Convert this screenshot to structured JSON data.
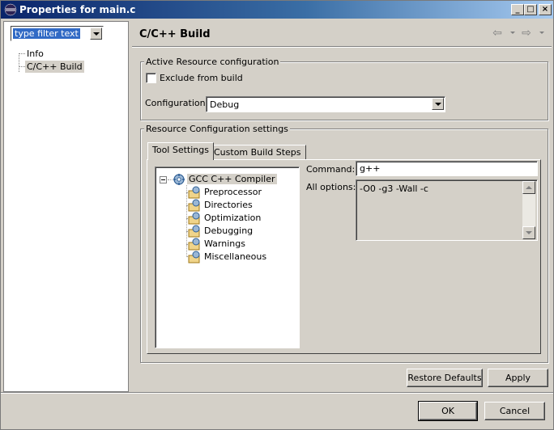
{
  "window": {
    "title": "Properties for main.c",
    "controls": {
      "minimize": "_",
      "maximize": "□",
      "close": "×"
    }
  },
  "sidebar": {
    "filter_text": "type filter text",
    "items": [
      {
        "label": "Info",
        "selected": false
      },
      {
        "label": "C/C++ Build",
        "selected": true
      }
    ]
  },
  "page": {
    "title": "C/C++ Build",
    "back_icon": "back-arrow-icon",
    "forward_icon": "forward-arrow-icon"
  },
  "active_resource": {
    "legend": "Active Resource configuration",
    "exclude_label": "Exclude from build",
    "exclude_checked": false,
    "configuration_label": "Configuration:",
    "configuration_value": "Debug"
  },
  "resource_settings": {
    "legend": "Resource Configuration settings",
    "tabs": [
      {
        "label": "Tool Settings",
        "active": true
      },
      {
        "label": "Custom Build Steps",
        "active": false
      }
    ],
    "tree": {
      "root": "GCC C++ Compiler",
      "children": [
        "Preprocessor",
        "Directories",
        "Optimization",
        "Debugging",
        "Warnings",
        "Miscellaneous"
      ]
    },
    "command_label": "Command:",
    "command_value": "g++",
    "all_options_label": "All options:",
    "all_options_value": "-O0 -g3 -Wall -c"
  },
  "buttons": {
    "restore_defaults": "Restore Defaults",
    "apply": "Apply",
    "ok": "OK",
    "cancel": "Cancel"
  },
  "colors": {
    "titlebar_start": "#0a246a",
    "titlebar_end": "#a6caf0",
    "selection": "#316ac5",
    "dialog_bg": "#d4d0c8"
  }
}
